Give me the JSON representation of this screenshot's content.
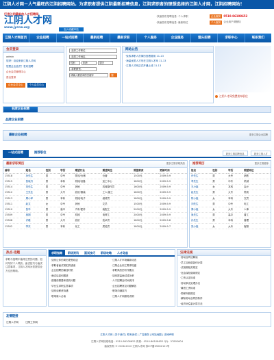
{
  "topbar": {
    "text": "江阴人才网－人气最旺的江阴招聘网站，为求职者提供江阴最新招聘信息，江阴求职者的理想选择的江阴人才网，江阴招聘网站！"
  },
  "logo": {
    "line1": "打造江阴最新的人才招聘网",
    "name": "江阴人才网",
    "url": "www.jyrcw.org",
    "home": "加入收藏本站"
  },
  "header_links": [
    "·快速发布招聘信息  ·个人求职",
    "·快速发布招聘信息  ·最新职位"
  ],
  "login_widget": {
    "tag": "企业服务",
    "phone": "0510-86108652",
    "muted": "企业用户请登陆",
    "tag2": "个人服务"
  },
  "nav": [
    "江阴人才网首页",
    "企业招聘",
    "一站式招聘",
    "最新招聘",
    "最新求职",
    "个人服务",
    "企业服务",
    "猎头招聘",
    "求职中心",
    "联系我们"
  ],
  "login": {
    "title": "会员登录",
    "user": "admin",
    "links": [
      "您好！欢迎来到江阴人才网",
      "您是企业会员？发布招聘"
    ],
    "red_links": [
      "企业会员管理中心",
      "退出登录"
    ],
    "btn_enterprise": "企业会员中心",
    "btn_personal": "个人会员中心"
  },
  "search": {
    "placeholder_job": "-选择工作职位-",
    "placeholder_area": "-选择工作地区-",
    "sel_edu": "性别",
    "sel_age": "年龄",
    "sel_exp": "学历",
    "sel_pay": "-求职薪资-",
    "keyword": "请输入要查询的关键字",
    "btn": "搜索"
  },
  "notice": {
    "title": "网站公告",
    "items": [
      "·免收求职人员简历查看费用 11-13",
      "·海量优质人才尽在江阴人才网 11-13",
      "·江阴人才网正式开通上线 11-13"
    ]
  },
  "sidead": {
    "link": "江阴人才网免费发布职位"
  },
  "bar1": {
    "label": "名牌企业招聘"
  },
  "bar2": {
    "label": "品牌企业招聘"
  },
  "bar3": {
    "label": "最新企业招聘",
    "more": "更多江阴企业招聘"
  },
  "tabs": {
    "items": [
      "一站式招聘",
      "推荐职位"
    ],
    "more1": "更多江阴招聘信息",
    "more2": "更多江阴人才"
  },
  "latest": {
    "title": "最新求职简历",
    "more": "更多江阴求职简历",
    "columns": [
      "编号",
      "姓名",
      "性别",
      "学历",
      "期望行业",
      "期望岗位",
      "期望薪资",
      "更新时间"
    ],
    "rows": [
      [
        "15518",
        "孙先生",
        "男",
        "中专",
        "物流/仓储",
        "仓管",
        "1500元",
        "2009-9-9"
      ],
      [
        "15515",
        "张晓丹",
        "男",
        "本科",
        "机械/设备",
        "加工中心",
        "1800元",
        "2009-9-9"
      ],
      [
        "15514",
        "刘先生",
        "男",
        "中专",
        "其他",
        "机械操作员",
        "1600元",
        "2009-9-9"
      ],
      [
        "15512",
        "王先生",
        "男",
        "大专",
        "纺织/服装",
        "工人/普工",
        "1800元",
        "2009-9-9"
      ],
      [
        "15513",
        "周小军",
        "男",
        "本科",
        "机械/电子",
        "维修员",
        "1800元",
        "2009-9-9"
      ],
      [
        "15511",
        "赵文",
        "女",
        "中专",
        "其他",
        "文员",
        "1500元",
        "2009-9-9"
      ],
      [
        "15510",
        "张华",
        "男",
        "高中",
        "汽车/配件",
        "装配工",
        "2000元",
        "2009-9-9"
      ],
      [
        "15509",
        "吴刚",
        "男",
        "中专",
        "机械",
        "电焊工",
        "2000元",
        "2009-9-9"
      ],
      [
        "15508",
        "许峰",
        "男",
        "大专",
        "纺织",
        "技术员",
        "1800元",
        "2009-9-8"
      ],
      [
        "15502",
        "李东",
        "男",
        "本科",
        "化工",
        "质检员",
        "1800元",
        "2009-9-7"
      ]
    ]
  },
  "fresh": {
    "title": "推荐简历",
    "more": "更多江阴推荐",
    "columns": [
      "姓名",
      "性别",
      "学历",
      "期望岗位"
    ],
    "rows": [
      [
        "许先生",
        "男",
        "大专",
        "销售"
      ],
      [
        "李先生",
        "男",
        "中专",
        "机械"
      ],
      [
        "王小姐",
        "女",
        "本科",
        "会计"
      ],
      [
        "赵先生",
        "男",
        "大专",
        "物流"
      ],
      [
        "陈小姐",
        "女",
        "本科",
        "文员"
      ],
      [
        "刘先生",
        "男",
        "中专",
        "电工"
      ],
      [
        "周小姐",
        "女",
        "大专",
        "人事"
      ],
      [
        "吴先生",
        "男",
        "高中",
        "普工"
      ],
      [
        "孙先生",
        "男",
        "本科",
        "管理"
      ],
      [
        "张小姐",
        "女",
        "大专",
        "客服"
      ]
    ]
  },
  "hot": {
    "title": "热点·话题",
    "text": "求职与招聘中值得注意的问题，如何写好个人简历，面试技巧与面试注意事项，江阴人才网为您提供全方位的帮助。"
  },
  "news": {
    "tabs": [
      "求职指南",
      "职场资讯",
      "面试技巧",
      "职场攻略",
      "人才动态"
    ],
    "col1": [
      "·如何让你的简历更受欢迎",
      "·求职者面试常犯的错误",
      "·企业招聘的最佳时机",
      "·面试后如何跟进",
      "·跳槽前需要考虑的问题",
      "·毕业生求职注意事项",
      "·如何谈薪资待遇",
      "·职场新人必读"
    ],
    "col2": [
      "·江阴人才市场最新动态",
      "·江阴企业用工需求旺盛",
      "·求职简历的写作要点",
      "·如何提高面试成功率",
      "·人才招聘会时间安排",
      "·企业招聘常见问题解答",
      "·职场沟通技巧",
      "·江阴人才网服务说明"
    ]
  },
  "law": {
    "title": "法律法规",
    "more": "更多法律法规",
    "items": [
      "·劳动合同法解读",
      "·员工加班费如何计算",
      "·试用期相关规定",
      "·社会保险缴纳规定",
      "·工伤认定标准",
      "·劳动争议处理办法",
      "·最低工资标准",
      "·带薪年假规定",
      "·解除劳动合同的条件",
      "·经济补偿金计算方法"
    ]
  },
  "friend": {
    "title": "友情链接",
    "links": [
      "江阴人才网",
      "江阴工作网"
    ]
  },
  "footer": {
    "links": "江阴人才网 | 关于我们 | 联系我们 | 广告服务 | 网站地图 | 法律声明",
    "line2": "江阴人才网热线电话：0510-86108652  传真：0510-86108652  QQ：57892604",
    "line3": "版权所有 © 2006-2010 江阴人才网  苏ICP备05062121号"
  }
}
